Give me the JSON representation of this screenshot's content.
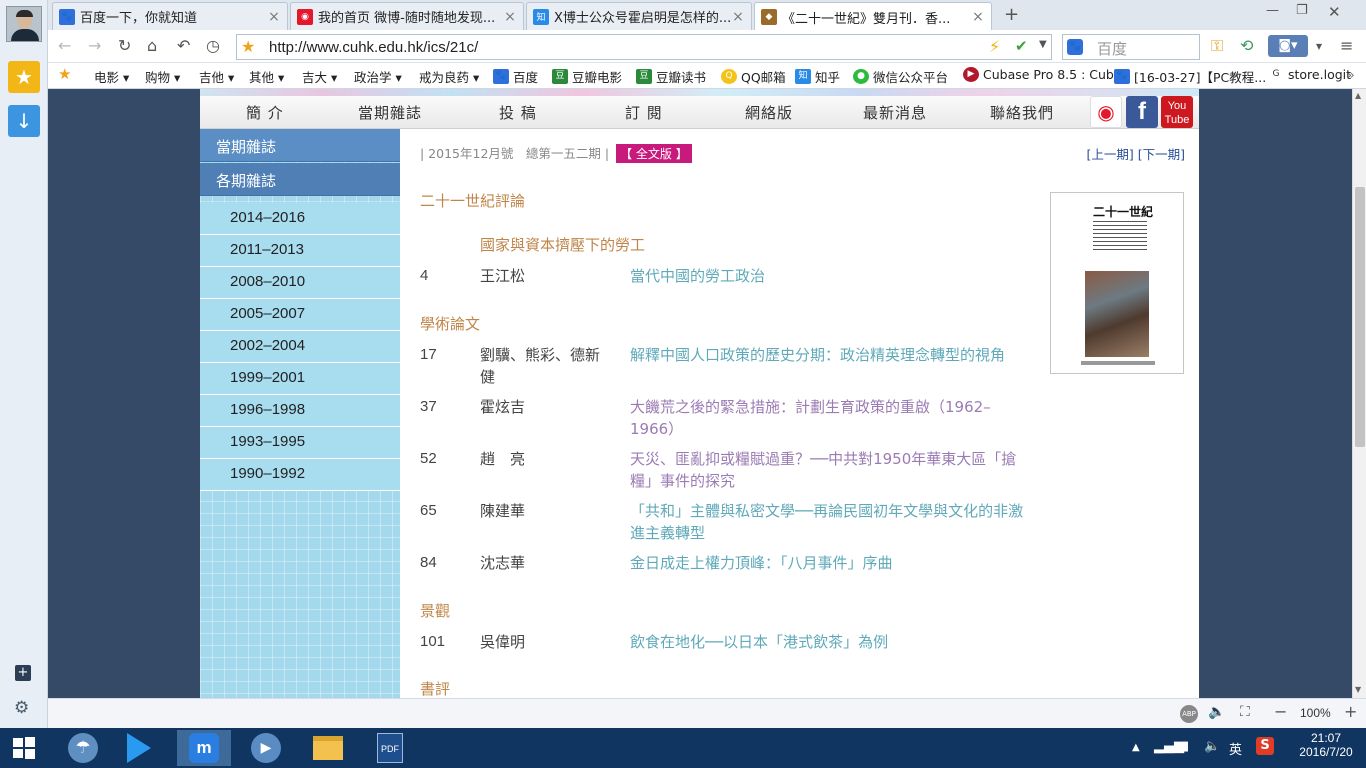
{
  "browser": {
    "tabs": [
      {
        "title": "百度一下，你就知道",
        "icon": "baidu-paw-icon",
        "color": "#2f6fdc"
      },
      {
        "title": "我的首页 微博-随时随地发现...",
        "icon": "weibo-icon",
        "color": "#e6162d"
      },
      {
        "title": "X博士公众号霍启明是怎样的...",
        "icon": "zhihu-icon",
        "color": "#2a8ae8"
      },
      {
        "title": "《二十一世紀》雙月刊．香...",
        "icon": "cuhk-icon",
        "color": "#9a6b2b"
      }
    ],
    "new_tab": "+",
    "url": "http://www.cuhk.edu.hk/ics/21c/",
    "search_placeholder": "百度",
    "bookmarks": [
      {
        "label": "电影 ▾"
      },
      {
        "label": "购物 ▾"
      },
      {
        "label": "吉他 ▾"
      },
      {
        "label": "其他 ▾"
      },
      {
        "label": "吉大 ▾"
      },
      {
        "label": "政治学 ▾"
      },
      {
        "label": "戒为良药 ▾"
      },
      {
        "label": "百度",
        "icon": "baidu-paw-icon"
      },
      {
        "label": "豆瓣电影",
        "icon": "douban-icon"
      },
      {
        "label": "豆瓣读书",
        "icon": "douban-icon"
      },
      {
        "label": "QQ邮箱",
        "icon": "qq-mail-icon"
      },
      {
        "label": "知乎",
        "icon": "zhihu-icon"
      },
      {
        "label": "微信公众平台",
        "icon": "wechat-icon"
      },
      {
        "label": "Cubase Pro 8.5 : Cub...",
        "icon": "cubase-icon"
      },
      {
        "label": "[16-03-27]【PC教程...",
        "icon": "baidu-paw-icon"
      },
      {
        "label": "store.logit",
        "icon": "logitech-icon"
      }
    ],
    "zoom": "100%"
  },
  "site": {
    "nav": [
      "簡 介",
      "當期雜誌",
      "投 稿",
      "訂 閱",
      "網絡版",
      "最新消息",
      "聯絡我們"
    ],
    "left_headings": [
      "當期雜誌",
      "各期雜誌"
    ],
    "years": [
      "2014–2016",
      "2011–2013",
      "2008–2010",
      "2005–2007",
      "2002–2004",
      "1999–2001",
      "1996–1998",
      "1993–1995",
      "1990–1992"
    ],
    "issue_info": "| 2015年12月號　總第一五二期 |",
    "full_version": "【 全文版 】",
    "prev_next": "[上一期] [下一期]",
    "cover_title": "二十一世紀",
    "sections": [
      {
        "name": "二十一世紀評論",
        "subtitle": "國家與資本擠壓下的勞工",
        "articles": [
          {
            "page": "4",
            "author": "王江松",
            "title": "當代中國的勞工政治"
          }
        ]
      },
      {
        "name": "學術論文",
        "subtitle": "",
        "articles": [
          {
            "page": "17",
            "author": "劉驥、熊彩、德新健",
            "title": "解釋中國人口政策的歷史分期：政治精英理念轉型的視角"
          },
          {
            "page": "37",
            "author": "霍炫吉",
            "title": "大饑荒之後的緊急措施：計劃生育政策的重啟（1962–1966）"
          },
          {
            "page": "52",
            "author": "趙　亮",
            "title": "天災、匪亂抑或糧賦過重？──中共對1950年華東大區「搶糧」事件的探究"
          },
          {
            "page": "65",
            "author": "陳建華",
            "title": "「共和」主體與私密文學──再論民國初年文學與文化的非激進主義轉型"
          },
          {
            "page": "84",
            "author": "沈志華",
            "title": "金日成走上權力頂峰：「八月事件」序曲"
          }
        ]
      },
      {
        "name": "景觀",
        "subtitle": "",
        "articles": [
          {
            "page": "101",
            "author": "吳偉明",
            "title": "飲食在地化──以日本「港式飲茶」為例"
          }
        ]
      },
      {
        "name": "書評",
        "subtitle": "",
        "articles": []
      }
    ]
  },
  "taskbar": {
    "ime": "英",
    "time": "21:07",
    "date": "2016/7/20"
  }
}
